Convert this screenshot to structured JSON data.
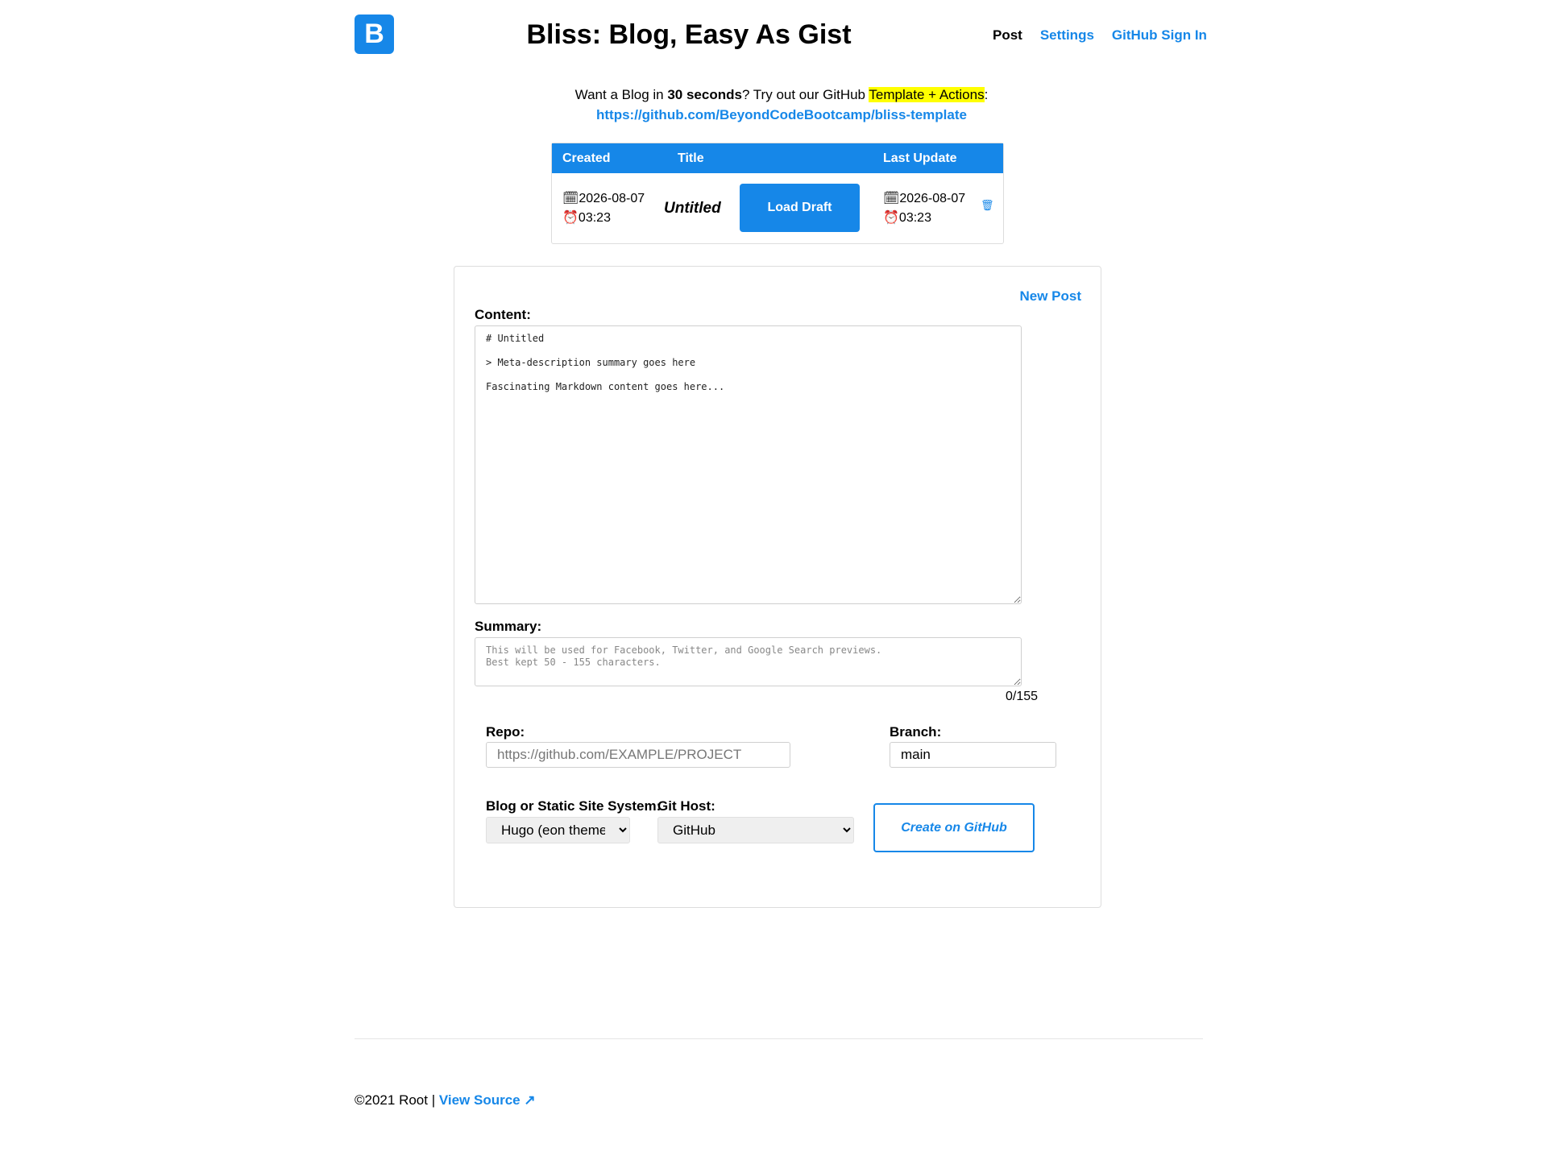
{
  "header": {
    "logo_letter": "B",
    "title": "Bliss: Blog, Easy As Gist",
    "nav": {
      "post": "Post",
      "settings": "Settings",
      "signin": "GitHub Sign In"
    }
  },
  "promo": {
    "text_before": "Want a Blog in ",
    "bold": "30 seconds",
    "text_middle": "? Try out our GitHub ",
    "highlight": "Template + Actions",
    "text_after": ":",
    "link": "https://github.com/BeyondCodeBootcamp/bliss-template"
  },
  "drafts": {
    "headers": {
      "created": "Created",
      "title": "Title",
      "updated": "Last Update"
    },
    "rows": [
      {
        "created_date": "🗓2026-08-07",
        "created_time": "⏰03:23",
        "title": "Untitled",
        "load_label": "Load Draft",
        "updated_date": "🗓2026-08-07",
        "updated_time": "⏰03:23",
        "delete_icon": "🗑"
      }
    ]
  },
  "editor": {
    "new_post": "New Post",
    "content_label": "Content:",
    "content_value": "# Untitled\n\n> Meta-description summary goes here\n\nFascinating Markdown content goes here...",
    "summary_label": "Summary:",
    "summary_placeholder": "This will be used for Facebook, Twitter, and Google Search previews.\nBest kept 50 - 155 characters.",
    "char_count": "0/155",
    "repo_label": "Repo:",
    "repo_placeholder": "https://github.com/EXAMPLE/PROJECT",
    "branch_label": "Branch:",
    "branch_value": "main",
    "system_label": "Blog or Static Site System:",
    "system_value": "Hugo (eon theme)",
    "host_label": "Git Host:",
    "host_value": "GitHub",
    "create_label": "Create on GitHub"
  },
  "footer": {
    "copyright": "©2021 Root | ",
    "view_source": "View Source ↗"
  },
  "colors": {
    "accent": "#1687e8",
    "highlight": "#ffff00"
  }
}
